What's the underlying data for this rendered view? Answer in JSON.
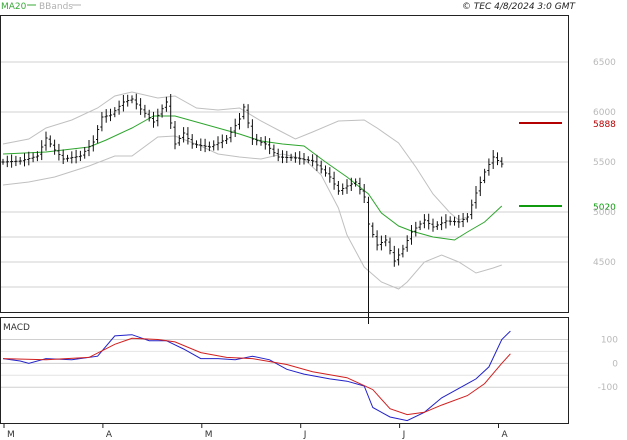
{
  "header": {
    "legend": [
      {
        "label": "MA20",
        "color": "#3aa83a"
      },
      {
        "label": "BBands",
        "color": "#b0b0b0"
      }
    ],
    "copyright": "© TEC 4/8/2024 3:0 GMT"
  },
  "chart_data": [
    {
      "type": "candlestick",
      "panel": "price",
      "yticks": [
        {
          "value": 45.0,
          "label": "4500"
        },
        {
          "value": 50.0,
          "label": "5000"
        },
        {
          "value": 55.0,
          "label": "5500"
        },
        {
          "value": 60.0,
          "label": "6000"
        },
        {
          "value": 65.0,
          "label": "6500"
        }
      ],
      "ylim": [
        40.0,
        69.6
      ],
      "grid": true,
      "month_ticks": [
        {
          "label": "M",
          "index": 0
        },
        {
          "label": "A",
          "index": 23
        },
        {
          "label": "M",
          "index": 46
        },
        {
          "label": "J",
          "index": 69
        },
        {
          "label": "J",
          "index": 92
        },
        {
          "label": "A",
          "index": 115
        }
      ],
      "n_days": 127,
      "ohlc_close_path": [
        [
          0,
          55.0
        ],
        [
          4,
          55.1
        ],
        [
          8,
          55.6
        ],
        [
          10,
          57.4
        ],
        [
          12,
          56.2
        ],
        [
          14,
          55.3
        ],
        [
          18,
          55.6
        ],
        [
          21,
          57.0
        ],
        [
          23,
          59.5
        ],
        [
          25,
          59.7
        ],
        [
          28,
          61.0
        ],
        [
          30,
          61.3
        ],
        [
          32,
          60.3
        ],
        [
          35,
          59.0
        ],
        [
          38,
          61.0
        ],
        [
          40,
          56.8
        ],
        [
          42,
          57.9
        ],
        [
          44,
          56.8
        ],
        [
          48,
          56.5
        ],
        [
          52,
          57.3
        ],
        [
          55,
          59.3
        ],
        [
          56,
          60.5
        ],
        [
          58,
          57.3
        ],
        [
          61,
          56.8
        ],
        [
          64,
          55.5
        ],
        [
          68,
          55.4
        ],
        [
          72,
          55.1
        ],
        [
          76,
          53.5
        ],
        [
          78,
          52.1
        ],
        [
          80,
          52.6
        ],
        [
          82,
          53.0
        ],
        [
          84,
          51.5
        ],
        [
          85,
          48.8
        ],
        [
          87,
          46.7
        ],
        [
          89,
          47.2
        ],
        [
          91,
          45.1
        ],
        [
          93,
          46.3
        ],
        [
          95,
          48.0
        ],
        [
          98,
          49.2
        ],
        [
          100,
          48.5
        ],
        [
          103,
          49.1
        ],
        [
          106,
          49.0
        ],
        [
          108,
          49.5
        ],
        [
          110,
          51.9
        ],
        [
          112,
          54.0
        ],
        [
          114,
          55.5
        ],
        [
          116,
          54.8
        ]
      ],
      "extremes": {
        "low": 38.8,
        "low_index": 85,
        "high": 61.8,
        "high_index": 39
      },
      "ma20_path": [
        [
          0,
          55.8
        ],
        [
          10,
          56.0
        ],
        [
          20,
          56.5
        ],
        [
          24,
          57.2
        ],
        [
          30,
          58.4
        ],
        [
          35,
          59.6
        ],
        [
          40,
          59.6
        ],
        [
          45,
          59.0
        ],
        [
          50,
          58.4
        ],
        [
          55,
          57.8
        ],
        [
          60,
          57.1
        ],
        [
          65,
          56.8
        ],
        [
          70,
          56.6
        ],
        [
          75,
          55.0
        ],
        [
          80,
          53.5
        ],
        [
          85,
          51.8
        ],
        [
          88,
          49.9
        ],
        [
          92,
          48.6
        ],
        [
          95,
          48.1
        ],
        [
          100,
          47.5
        ],
        [
          105,
          47.2
        ],
        [
          108,
          48.0
        ],
        [
          112,
          49.0
        ],
        [
          116,
          50.6
        ]
      ],
      "bband_upper_path": [
        [
          0,
          56.8
        ],
        [
          6,
          57.3
        ],
        [
          10,
          58.4
        ],
        [
          16,
          59.2
        ],
        [
          22,
          60.4
        ],
        [
          26,
          61.6
        ],
        [
          30,
          62.0
        ],
        [
          36,
          61.4
        ],
        [
          40,
          61.6
        ],
        [
          45,
          60.4
        ],
        [
          50,
          60.2
        ],
        [
          55,
          60.4
        ],
        [
          60,
          59.1
        ],
        [
          64,
          58.2
        ],
        [
          68,
          57.3
        ],
        [
          72,
          58.0
        ],
        [
          78,
          59.1
        ],
        [
          84,
          59.2
        ],
        [
          87,
          58.4
        ],
        [
          92,
          56.9
        ],
        [
          96,
          54.5
        ],
        [
          100,
          51.8
        ],
        [
          104,
          49.9
        ],
        [
          106,
          49.2
        ],
        [
          108,
          49.5
        ]
      ],
      "bband_lower_path": [
        [
          0,
          52.7
        ],
        [
          6,
          53.0
        ],
        [
          12,
          53.5
        ],
        [
          20,
          54.6
        ],
        [
          26,
          55.6
        ],
        [
          30,
          55.6
        ],
        [
          36,
          57.5
        ],
        [
          40,
          57.6
        ],
        [
          46,
          56.6
        ],
        [
          50,
          55.8
        ],
        [
          55,
          55.5
        ],
        [
          60,
          55.3
        ],
        [
          65,
          55.8
        ],
        [
          70,
          55.3
        ],
        [
          74,
          53.7
        ],
        [
          78,
          50.4
        ],
        [
          80,
          47.7
        ],
        [
          84,
          44.5
        ],
        [
          88,
          43.0
        ],
        [
          92,
          42.3
        ],
        [
          94,
          43.0
        ],
        [
          98,
          45.0
        ],
        [
          102,
          45.7
        ],
        [
          106,
          45.0
        ],
        [
          110,
          43.9
        ],
        [
          114,
          44.4
        ],
        [
          116,
          44.7
        ]
      ],
      "levels": [
        {
          "label": "5888",
          "value": 58.9,
          "color": "#b40000"
        },
        {
          "label": "5020",
          "value": 50.6,
          "color": "#109a10"
        }
      ]
    },
    {
      "type": "line",
      "panel": "MACD",
      "title": "MACD",
      "yticks": [
        {
          "value": 100,
          "label": "100"
        },
        {
          "value": 0,
          "label": "0"
        },
        {
          "value": -100,
          "label": "-100"
        }
      ],
      "ylim": [
        -250,
        190
      ],
      "series": [
        {
          "color": "#2222c8",
          "points": [
            [
              0,
              20
            ],
            [
              4,
              10
            ],
            [
              6,
              0
            ],
            [
              10,
              20
            ],
            [
              16,
              15
            ],
            [
              22,
              30
            ],
            [
              26,
              115
            ],
            [
              30,
              120
            ],
            [
              34,
              95
            ],
            [
              38,
              95
            ],
            [
              42,
              60
            ],
            [
              46,
              20
            ],
            [
              50,
              20
            ],
            [
              54,
              15
            ],
            [
              58,
              30
            ],
            [
              62,
              15
            ],
            [
              66,
              -25
            ],
            [
              70,
              -45
            ],
            [
              76,
              -65
            ],
            [
              80,
              -75
            ],
            [
              84,
              -95
            ],
            [
              86,
              -185
            ],
            [
              90,
              -225
            ],
            [
              94,
              -240
            ],
            [
              98,
              -205
            ],
            [
              102,
              -145
            ],
            [
              106,
              -105
            ],
            [
              110,
              -65
            ],
            [
              113,
              -15
            ],
            [
              116,
              100
            ],
            [
              118,
              135
            ]
          ]
        },
        {
          "color": "#d02020",
          "points": [
            [
              0,
              20
            ],
            [
              10,
              15
            ],
            [
              20,
              25
            ],
            [
              26,
              80
            ],
            [
              30,
              105
            ],
            [
              36,
              100
            ],
            [
              40,
              90
            ],
            [
              46,
              45
            ],
            [
              52,
              25
            ],
            [
              58,
              20
            ],
            [
              66,
              -5
            ],
            [
              72,
              -35
            ],
            [
              80,
              -60
            ],
            [
              86,
              -110
            ],
            [
              90,
              -190
            ],
            [
              94,
              -215
            ],
            [
              98,
              -205
            ],
            [
              102,
              -175
            ],
            [
              108,
              -135
            ],
            [
              112,
              -85
            ],
            [
              116,
              0
            ],
            [
              118,
              40
            ]
          ]
        }
      ]
    }
  ]
}
